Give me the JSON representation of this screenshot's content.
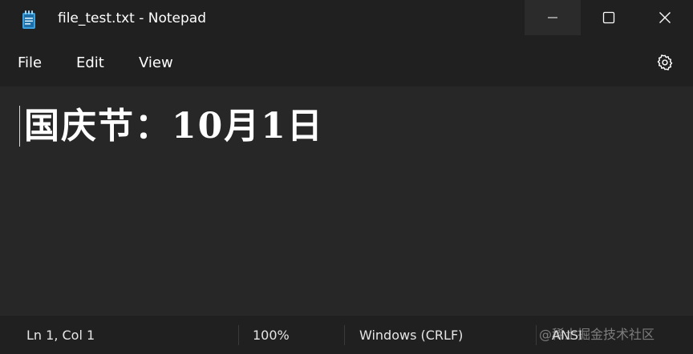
{
  "window": {
    "title": "file_test.txt - Notepad",
    "icon": "notepad-icon"
  },
  "controls": {
    "minimize_icon": "minimize-icon",
    "maximize_icon": "maximize-icon",
    "close_icon": "close-icon"
  },
  "menu": {
    "file": "File",
    "edit": "Edit",
    "view": "View",
    "settings_icon": "gear-icon"
  },
  "editor": {
    "content": "国庆节：10月1日"
  },
  "status": {
    "position": "Ln 1, Col 1",
    "zoom": "100%",
    "line_endings": "Windows (CRLF)",
    "encoding": "ANSI"
  },
  "watermark": "@稀土掘金技术社区",
  "colors": {
    "titlebar": "#202020",
    "editor_bg": "#272727",
    "text": "#ffffff",
    "icon_accent": "#3aa0e0"
  }
}
